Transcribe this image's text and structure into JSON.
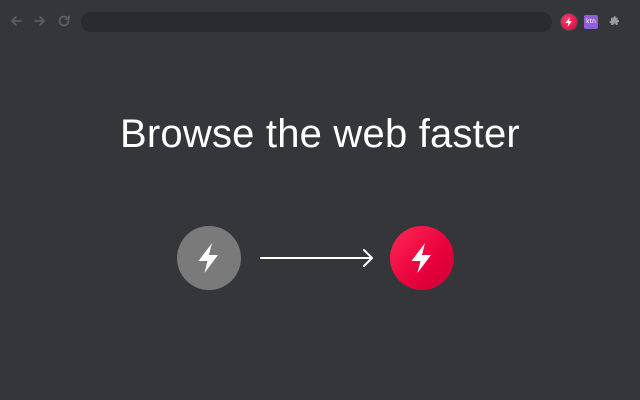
{
  "browser": {
    "address_bar": {
      "value": ""
    },
    "toolbar_icons": [
      "back-arrow-icon",
      "forward-arrow-icon",
      "reload-icon"
    ],
    "extensions": [
      {
        "name": "lightning-bolt-icon",
        "color": "#e8003c"
      },
      {
        "name": "purple-extension-icon",
        "label": "ktn",
        "color": "#8f5fd6"
      },
      {
        "name": "puzzle-piece-icon"
      }
    ]
  },
  "hero": {
    "headline": "Browse the web faster",
    "before_icon": {
      "name": "lightning-bolt-icon",
      "color": "#7a7a7a"
    },
    "after_icon": {
      "name": "lightning-bolt-icon",
      "color": "#e8003c"
    },
    "connector": "right-arrow-icon"
  },
  "colors": {
    "background": "#35363a",
    "accent": "#e8003c",
    "text": "#ffffff"
  }
}
